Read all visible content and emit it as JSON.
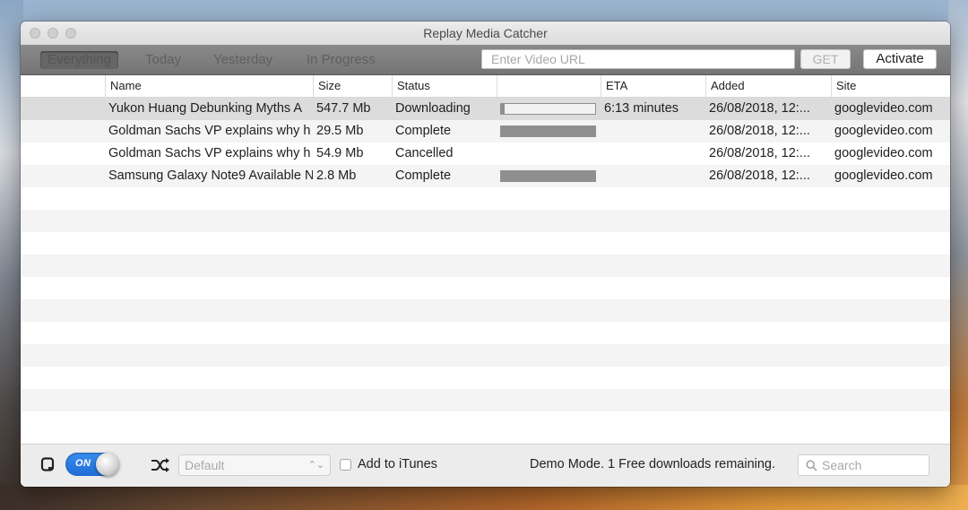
{
  "window": {
    "title": "Replay Media Catcher"
  },
  "toolbar": {
    "tabs": [
      {
        "label": "Everything",
        "selected": true
      },
      {
        "label": "Today",
        "selected": false
      },
      {
        "label": "Yesterday",
        "selected": false
      },
      {
        "label": "In Progress",
        "selected": false
      }
    ],
    "url_placeholder": "Enter Video URL",
    "get_label": "GET",
    "activate_label": "Activate"
  },
  "table": {
    "columns": [
      "Name",
      "Size",
      "Status",
      "",
      "ETA",
      "Added",
      "Site"
    ],
    "rows": [
      {
        "name": "Yukon Huang Debunking Myths A",
        "size": "547.7 Mb",
        "status": "Downloading",
        "progress": 0.04,
        "eta": "6:13 minutes",
        "added": "26/08/2018, 12:...",
        "site": "googlevideo.com"
      },
      {
        "name": "Goldman Sachs VP explains why h",
        "size": "29.5 Mb",
        "status": "Complete",
        "progress": 1.0,
        "eta": "",
        "added": "26/08/2018, 12:...",
        "site": "googlevideo.com"
      },
      {
        "name": "Goldman Sachs VP explains why h",
        "size": "54.9 Mb",
        "status": "Cancelled",
        "progress": null,
        "eta": "",
        "added": "26/08/2018, 12:...",
        "site": "googlevideo.com"
      },
      {
        "name": "Samsung Galaxy Note9 Available N",
        "size": "2.8 Mb",
        "status": "Complete",
        "progress": 1.0,
        "eta": "",
        "added": "26/08/2018, 12:...",
        "site": "googlevideo.com"
      }
    ]
  },
  "statusbar": {
    "toggle_label": "ON",
    "preset_value": "Default",
    "add_to_itunes_label": "Add to iTunes",
    "demo_text": "Demo Mode.  1 Free downloads remaining.",
    "search_placeholder": "Search"
  },
  "colors": {
    "toggle_blue": "#2a7de8",
    "progress_gray": "#8f8f8f",
    "selected_row": "#dcdcdc"
  }
}
